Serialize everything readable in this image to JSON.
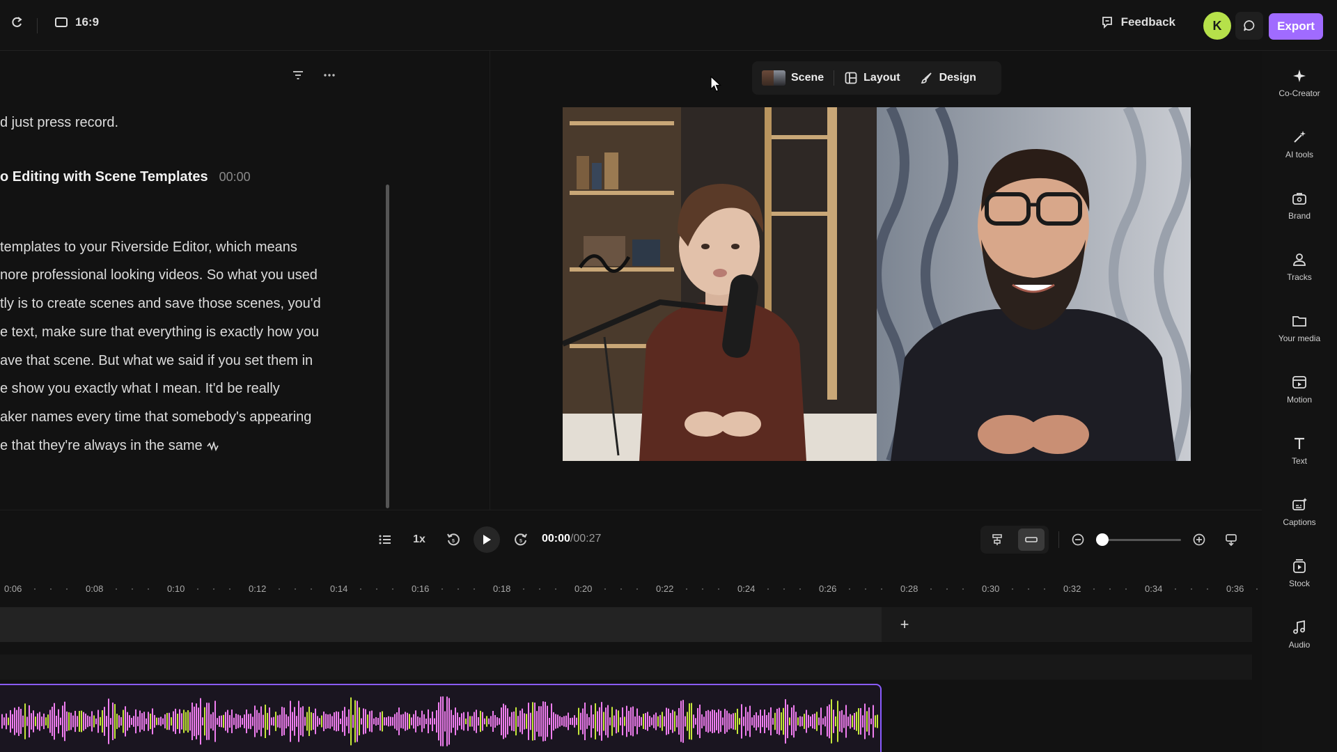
{
  "topbar": {
    "aspect_ratio": "16:9",
    "feedback": "Feedback",
    "avatar_initial": "K",
    "export": "Export"
  },
  "transcript": {
    "line0": "d just press record.",
    "heading": "o Editing with Scene Templates",
    "heading_time": "00:00",
    "lines": [
      "templates to your Riverside Editor,  which means",
      "nore professional looking videos. So what you used",
      "tly is to create scenes and save those scenes, you'd",
      "e text, make sure that everything is exactly how you",
      "ave that scene. But what we said if you set them in",
      "e show you exactly what I mean. It'd be really",
      "aker names every time that somebody's appearing",
      "e that they're always in the same"
    ]
  },
  "scenebar": {
    "scene": "Scene",
    "layout": "Layout",
    "design": "Design"
  },
  "playback": {
    "speed": "1x",
    "current": "00:00",
    "total": "/00:27"
  },
  "timeline": {
    "ticks": [
      "0:06",
      "0:08",
      "0:10",
      "0:12",
      "0:14",
      "0:16",
      "0:18",
      "0:20",
      "0:22",
      "0:24",
      "0:26",
      "0:28",
      "0:30",
      "0:32",
      "0:34",
      "0:36"
    ],
    "add": "+"
  },
  "sidebar": {
    "items": [
      {
        "label": "Co-Creator",
        "icon": "sparkle-icon"
      },
      {
        "label": "AI tools",
        "icon": "magic-wand-icon"
      },
      {
        "label": "Brand",
        "icon": "brand-kit-icon"
      },
      {
        "label": "Tracks",
        "icon": "people-icon"
      },
      {
        "label": "Your media",
        "icon": "folder-icon"
      },
      {
        "label": "Motion",
        "icon": "motion-icon"
      },
      {
        "label": "Text",
        "icon": "text-icon"
      },
      {
        "label": "Captions",
        "icon": "captions-icon"
      },
      {
        "label": "Stock",
        "icon": "stock-icon"
      },
      {
        "label": "Audio",
        "icon": "music-note-icon"
      }
    ]
  },
  "colors": {
    "accent": "#a06bff",
    "avatar": "#b6e14a",
    "waveform_pink": "#f07ef0",
    "waveform_lime": "#c6e83a"
  }
}
